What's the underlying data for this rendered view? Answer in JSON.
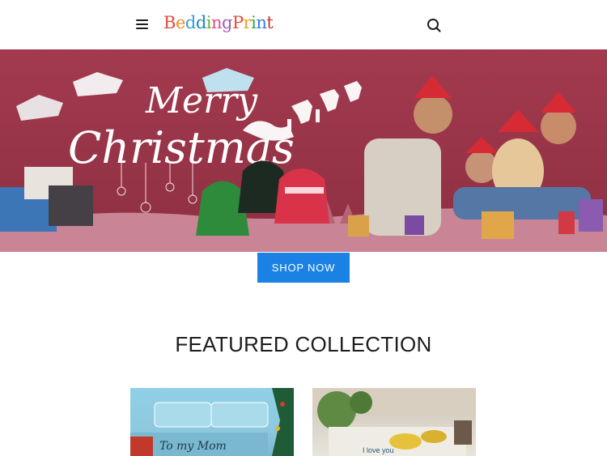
{
  "header": {
    "logo_text": "BeddingPrint",
    "logo_letters": [
      {
        "char": "B",
        "color": "#e04a3a"
      },
      {
        "char": "e",
        "color": "#f08a24"
      },
      {
        "char": "d",
        "color": "#2e9ee0"
      },
      {
        "char": "d",
        "color": "#1a8cc0"
      },
      {
        "char": "i",
        "color": "#6bb33b"
      },
      {
        "char": "n",
        "color": "#e04a8a"
      },
      {
        "char": "g",
        "color": "#9b59b6"
      },
      {
        "char": "P",
        "color": "#e04a3a"
      },
      {
        "char": "r",
        "color": "#f0a020"
      },
      {
        "char": "i",
        "color": "#2ea84a"
      },
      {
        "char": "n",
        "color": "#2e7be0"
      },
      {
        "char": "t",
        "color": "#c0392b"
      }
    ],
    "menu_icon": "hamburger-menu-icon",
    "search_icon": "search-icon"
  },
  "banner": {
    "headline_line1": "Merry",
    "headline_line2": "Christmas",
    "background_color": "#a23a4d"
  },
  "hero": {
    "cta_label": "SHOP NOW",
    "cta_color": "#1a82e5"
  },
  "featured": {
    "title": "FEATURED COLLECTION",
    "products": [
      {
        "image_text": "To my Mom"
      },
      {
        "image_text": "I love you"
      }
    ]
  }
}
